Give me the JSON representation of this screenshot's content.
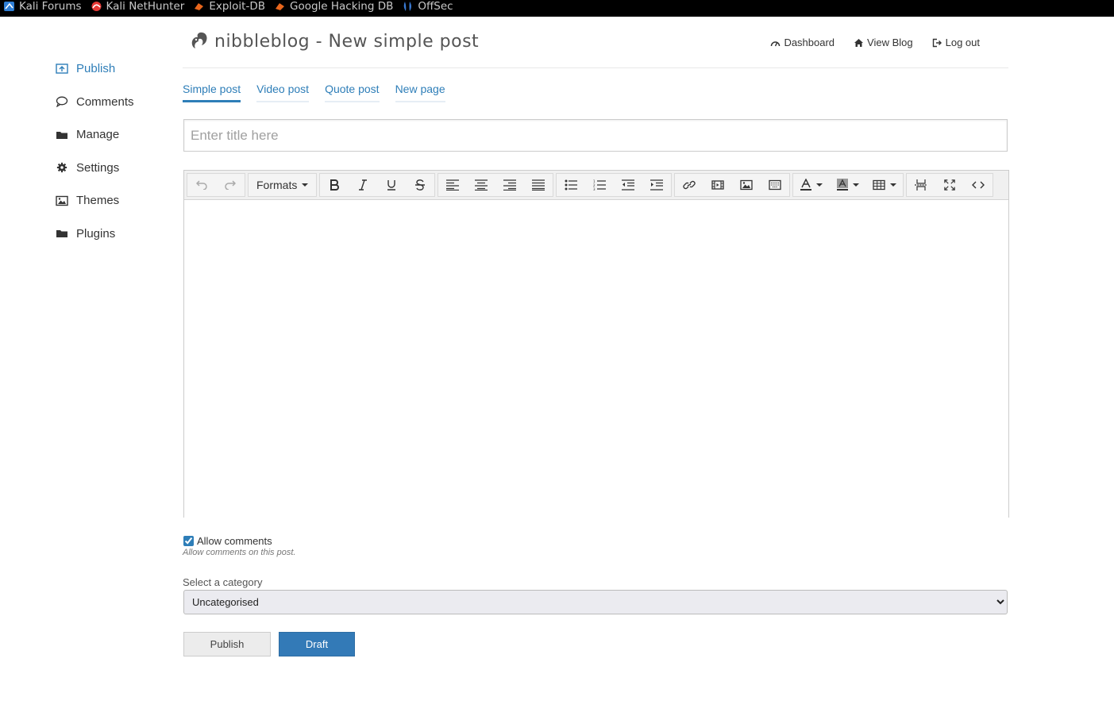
{
  "bookmarks": [
    {
      "label": "Kali Forums",
      "icon": "kali-forums-icon"
    },
    {
      "label": "Kali NetHunter",
      "icon": "nethunter-icon"
    },
    {
      "label": "Exploit-DB",
      "icon": "exploit-db-icon"
    },
    {
      "label": "Google Hacking DB",
      "icon": "ghdb-icon"
    },
    {
      "label": "OffSec",
      "icon": "offsec-icon"
    }
  ],
  "sidebar": {
    "items": [
      {
        "label": "Publish",
        "icon": "publish-icon",
        "active": true
      },
      {
        "label": "Comments",
        "icon": "comment-icon"
      },
      {
        "label": "Manage",
        "icon": "folder-icon"
      },
      {
        "label": "Settings",
        "icon": "gear-icon"
      },
      {
        "label": "Themes",
        "icon": "image-icon"
      },
      {
        "label": "Plugins",
        "icon": "folder-icon"
      }
    ]
  },
  "header": {
    "title": "nibbleblog - New simple post",
    "nav": [
      {
        "label": "Dashboard",
        "icon": "dashboard-icon"
      },
      {
        "label": "View Blog",
        "icon": "home-icon"
      },
      {
        "label": "Log out",
        "icon": "logout-icon"
      }
    ]
  },
  "tabs": [
    {
      "label": "Simple post",
      "active": true
    },
    {
      "label": "Video post"
    },
    {
      "label": "Quote post"
    },
    {
      "label": "New page"
    }
  ],
  "post": {
    "title_placeholder": "Enter title here",
    "title_value": ""
  },
  "editor": {
    "formats_label": "Formats"
  },
  "comments": {
    "allow_label": "Allow comments",
    "allow_checked": true,
    "help": "Allow comments on this post."
  },
  "category": {
    "label": "Select a category",
    "selected": "Uncategorised"
  },
  "buttons": {
    "publish": "Publish",
    "draft": "Draft"
  },
  "colors": {
    "accent": "#2e7eb8",
    "draft_button": "#337ab7",
    "bookmarks_bar": "#000000"
  }
}
